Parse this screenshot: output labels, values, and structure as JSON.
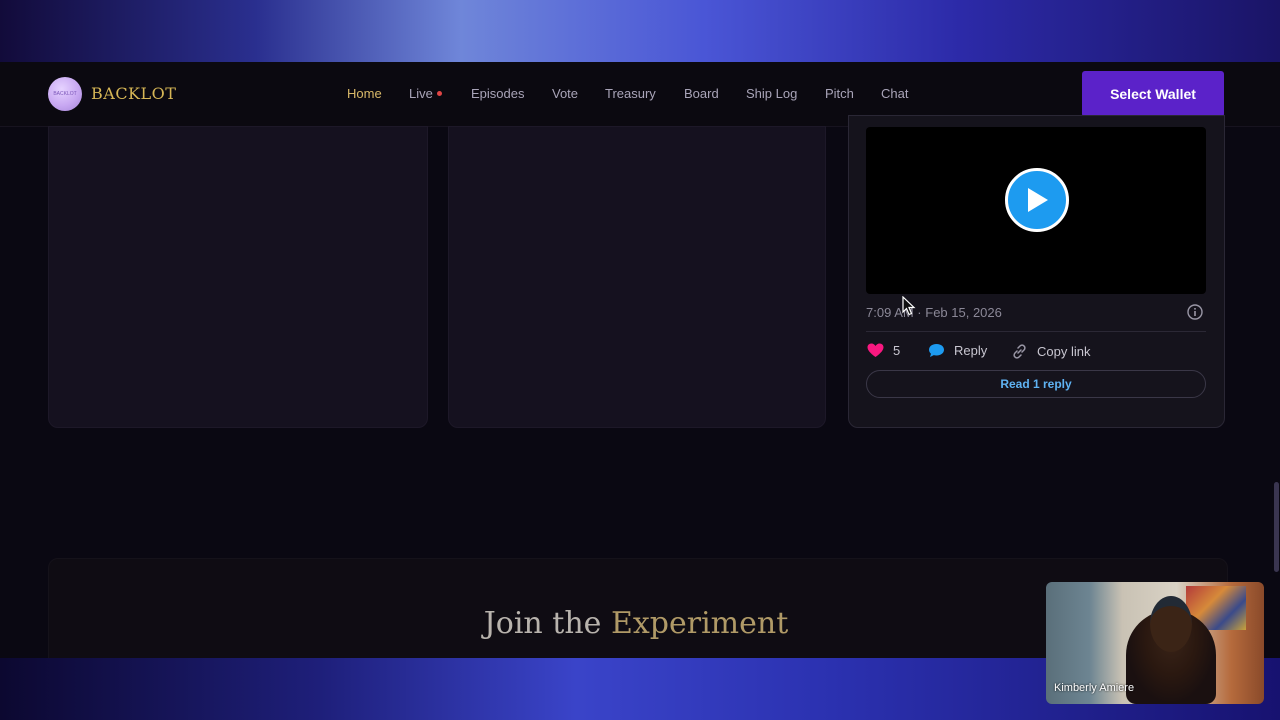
{
  "brand": {
    "name": "BACKLOT",
    "logo_text": "BACKLOT"
  },
  "nav": {
    "items": [
      {
        "label": "Home",
        "active": true
      },
      {
        "label": "Live",
        "live": true
      },
      {
        "label": "Episodes"
      },
      {
        "label": "Vote"
      },
      {
        "label": "Treasury"
      },
      {
        "label": "Board"
      },
      {
        "label": "Ship Log"
      },
      {
        "label": "Pitch"
      },
      {
        "label": "Chat"
      }
    ],
    "wallet_button": "Select Wallet"
  },
  "tweet": {
    "timestamp": "7:09 AM · Feb 15, 2026",
    "likes": "5",
    "reply_label": "Reply",
    "copy_link_label": "Copy link",
    "read_replies_label": "Read 1 reply"
  },
  "join": {
    "title_prefix": "Join the",
    "title_accent": "Experiment"
  },
  "webcam": {
    "participant_name": "Kimberly Amiere"
  },
  "colors": {
    "accent_gold": "#d8b868",
    "wallet_purple": "#5b22c9",
    "like_pink": "#f91880",
    "twitter_blue": "#1d9bf0"
  }
}
